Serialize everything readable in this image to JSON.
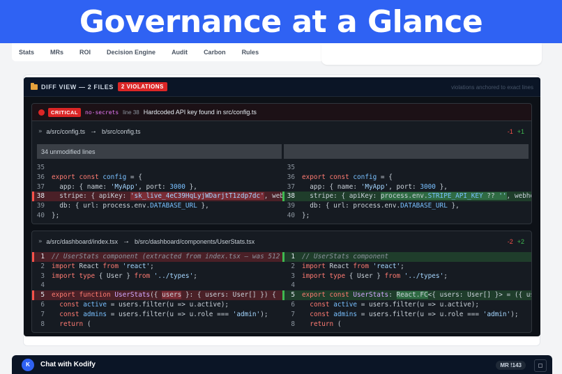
{
  "banner": {
    "title": "Governance at a Glance"
  },
  "nav": {
    "items": [
      "Stats",
      "MRs",
      "ROI",
      "Decision Engine",
      "Audit",
      "Carbon",
      "Rules"
    ]
  },
  "diff_view": {
    "title": "DIFF VIEW — 2 FILES",
    "badge": "2 VIOLATIONS",
    "right_note": "violations anchored to exact lines"
  },
  "file1": {
    "violation": {
      "severity": "CRITICAL",
      "rule": "no-secrets",
      "line_ref": "line 38",
      "message": "Hardcoded API key found in src/config.ts"
    },
    "path_a": "a/src/config.ts",
    "path_b": "b/src/config.ts",
    "deletions": "-1",
    "additions": "+1",
    "unmodified": "34 unmodified lines",
    "line_numbers": [
      "35",
      "36",
      "37",
      "38",
      "39",
      "40"
    ]
  },
  "file2": {
    "path_a": "a/src/dashboard/index.tsx",
    "path_b": "b/src/dashboard/components/UserStats.tsx",
    "deletions": "-2",
    "additions": "+2",
    "line_numbers": [
      "1",
      "2",
      "3",
      "4",
      "5",
      "6",
      "7",
      "8"
    ]
  },
  "chat": {
    "icon_text": "K",
    "title": "Chat with Kodify",
    "mr_badge": "MR !143"
  },
  "colors": {
    "brand_blue": "#2f62f3",
    "critical_red": "#dc2626",
    "diff_bg": "#0d1117",
    "add_green": "#3fb950",
    "del_red": "#f85149"
  }
}
